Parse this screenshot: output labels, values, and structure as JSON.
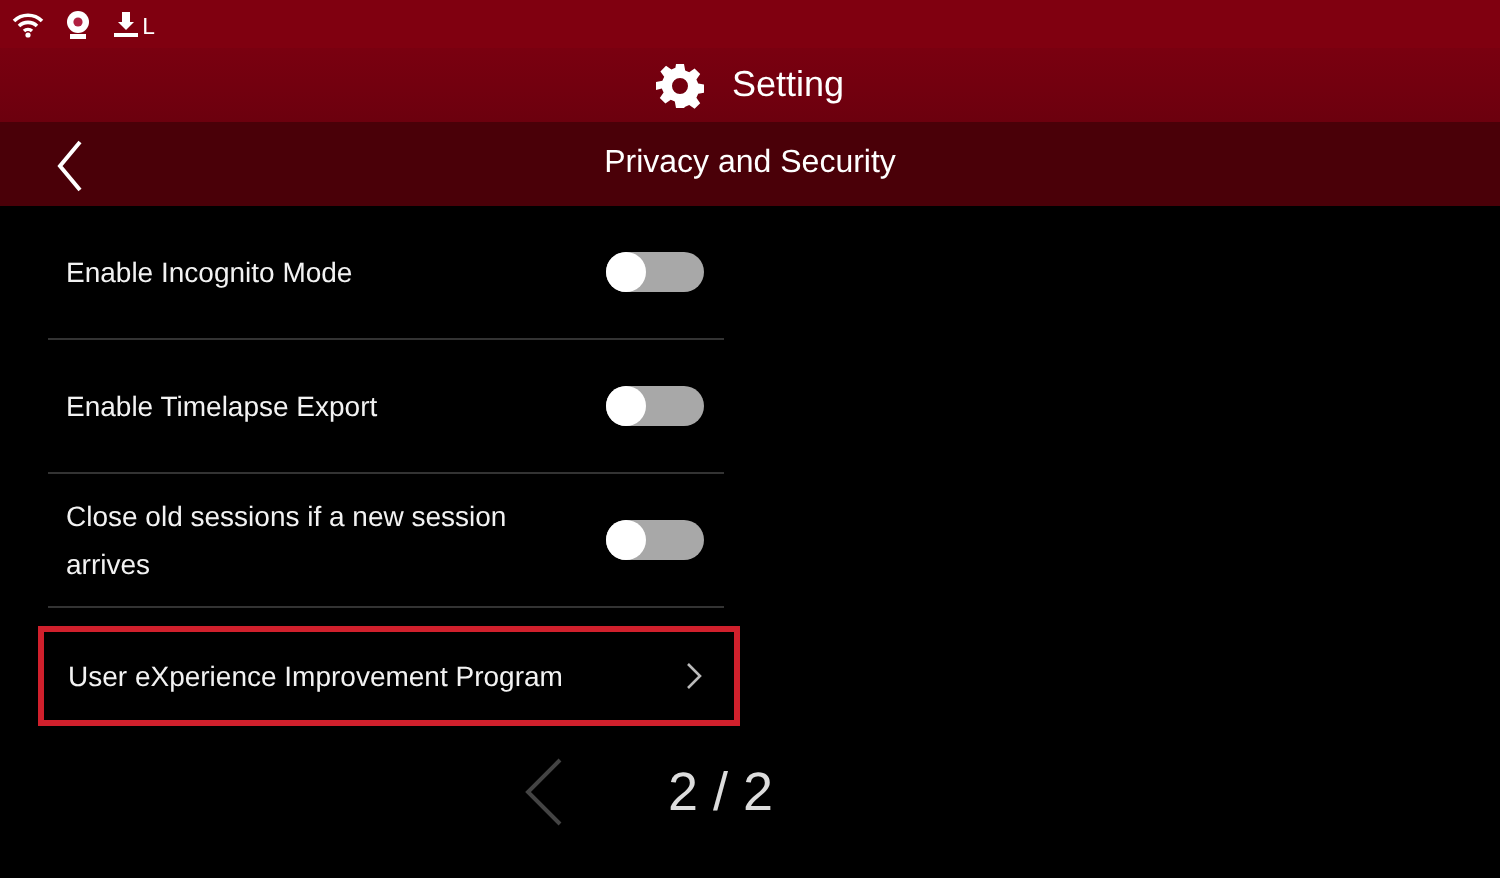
{
  "status_bar": {
    "printer_label": "L"
  },
  "title_bar": {
    "title": "Setting"
  },
  "header": {
    "title": "Privacy and Security"
  },
  "items": [
    {
      "kind": "toggle",
      "label": "Enable Incognito Mode",
      "on": false,
      "highlighted": false
    },
    {
      "kind": "toggle",
      "label": "Enable Timelapse Export",
      "on": false,
      "highlighted": false
    },
    {
      "kind": "toggle",
      "label": "Close old sessions if a new session arrives",
      "on": false,
      "highlighted": false
    },
    {
      "kind": "link",
      "label": "User eXperience Improvement Program",
      "highlighted": true
    }
  ],
  "pager": {
    "text": "2 / 2",
    "prev_disabled": true
  }
}
